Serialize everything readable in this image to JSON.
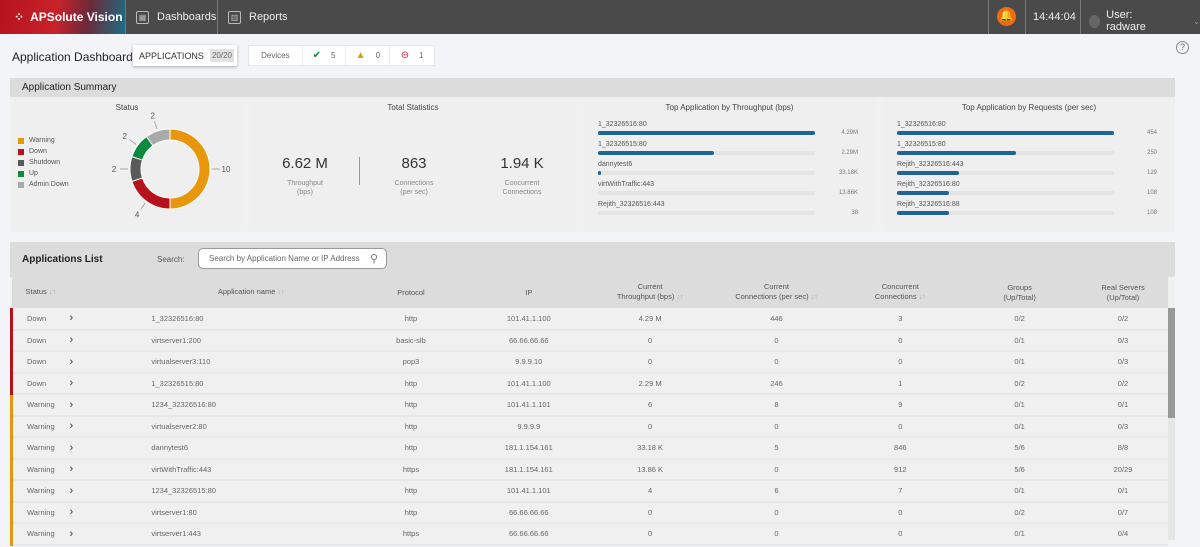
{
  "topbar": {
    "brand": "APSolute Vision",
    "nav": [
      {
        "label": "Dashboards",
        "icon": "dashboard-icon"
      },
      {
        "label": "Reports",
        "icon": "report-icon"
      }
    ],
    "time": "14:44:04",
    "user": "User: radware"
  },
  "page": {
    "title": "Application Dashboard",
    "applications_label": "APPLICATIONS",
    "applications_count": "20/20",
    "devices_label": "Devices",
    "devices_ok": "5",
    "devices_warning": "0",
    "devices_error": "1"
  },
  "summary": {
    "title": "Application Summary",
    "status": {
      "title": "Status",
      "segments": [
        {
          "label": "Warning",
          "value": 10,
          "color": "#e8960c"
        },
        {
          "label": "Down",
          "value": 4,
          "color": "#b5121b"
        },
        {
          "label": "Shutdown",
          "value": 2,
          "color": "#5a5a5a"
        },
        {
          "label": "Up",
          "value": 2,
          "color": "#0a8a3c"
        },
        {
          "label": "Admin Down",
          "value": 2,
          "color": "#a9a9a9"
        }
      ]
    },
    "totals": {
      "title": "Total Statistics",
      "items": [
        {
          "value": "6.62 M",
          "label1": "Throughput",
          "label2": "(bps)"
        },
        {
          "value": "863",
          "label1": "Connections",
          "label2": "(per sec)"
        },
        {
          "value": "1.94 K",
          "label1": "Concurrent",
          "label2": "Connections"
        }
      ]
    },
    "throughput": {
      "title": "Top Application by Throughput (bps)",
      "items": [
        {
          "name": "1_32326516:80",
          "value": 4290000,
          "label": "4.29M"
        },
        {
          "name": "1_32326515:80",
          "value": 2290000,
          "label": "2.29M"
        },
        {
          "name": "dannytest6",
          "value": 33180,
          "label": "33.18K"
        },
        {
          "name": "virtWithTraffic:443",
          "value": 13860,
          "label": "13.86K"
        },
        {
          "name": "Rejith_32326516:443",
          "value": 38,
          "label": "38"
        }
      ]
    },
    "requests": {
      "title": "Top Application by Requests (per sec)",
      "items": [
        {
          "name": "1_32326516:80",
          "value": 454,
          "label": "454"
        },
        {
          "name": "1_32326515:80",
          "value": 250,
          "label": "250"
        },
        {
          "name": "Rejith_32326516:443",
          "value": 129,
          "label": "129"
        },
        {
          "name": "Rejith_32326516:80",
          "value": 108,
          "label": "108"
        },
        {
          "name": "Rejith_32326516:88",
          "value": 108,
          "label": "108"
        }
      ]
    }
  },
  "list": {
    "title": "Applications List",
    "search_label": "Search:",
    "search_placeholder": "Search by Application Name or IP Address",
    "columns": [
      "Status",
      "Application name",
      "Protocol",
      "IP",
      "Current\nThroughput (bps)",
      "Current\nConnections (per sec)",
      "Concurrent\nConnections",
      "Groups\n(Up/Total)",
      "Real Servers\n(Up/Total)"
    ],
    "rows": [
      [
        "Down",
        "1_32326516:80",
        "http",
        "101.41.1.100",
        "4.29 M",
        "446",
        "3",
        "0/2",
        "0/2"
      ],
      [
        "Down",
        "virtserver1:200",
        "basic-slb",
        "66.66.66.66",
        "0",
        "0",
        "0",
        "0/1",
        "0/3"
      ],
      [
        "Down",
        "virtualserver3:110",
        "pop3",
        "9.9.9.10",
        "0",
        "0",
        "0",
        "0/1",
        "0/3"
      ],
      [
        "Down",
        "1_32326515:80",
        "http",
        "101.41.1.100",
        "2.29 M",
        "246",
        "1",
        "0/2",
        "0/2"
      ],
      [
        "Warning",
        "1234_32326516:80",
        "http",
        "101.41.1.101",
        "6",
        "8",
        "9",
        "0/1",
        "0/1"
      ],
      [
        "Warning",
        "virtualserver2:80",
        "http",
        "9.9.9.9",
        "0",
        "0",
        "0",
        "0/1",
        "0/3"
      ],
      [
        "Warning",
        "dannytest6",
        "http",
        "181.1.154.161",
        "33.18 K",
        "5",
        "846",
        "5/6",
        "8/8"
      ],
      [
        "Warning",
        "virtWithTraffic:443",
        "https",
        "181.1.154.161",
        "13.86 K",
        "0",
        "912",
        "5/6",
        "20/29"
      ],
      [
        "Warning",
        "1234_32326515:80",
        "http",
        "101.41.1.101",
        "4",
        "6",
        "7",
        "0/1",
        "0/1"
      ],
      [
        "Warning",
        "virtserver1:80",
        "http",
        "66.66.66.66",
        "0",
        "0",
        "0",
        "0/2",
        "0/7"
      ],
      [
        "Warning",
        "virtserver1:443",
        "https",
        "66.66.66.66",
        "0",
        "0",
        "0",
        "0/1",
        "0/4"
      ]
    ]
  }
}
